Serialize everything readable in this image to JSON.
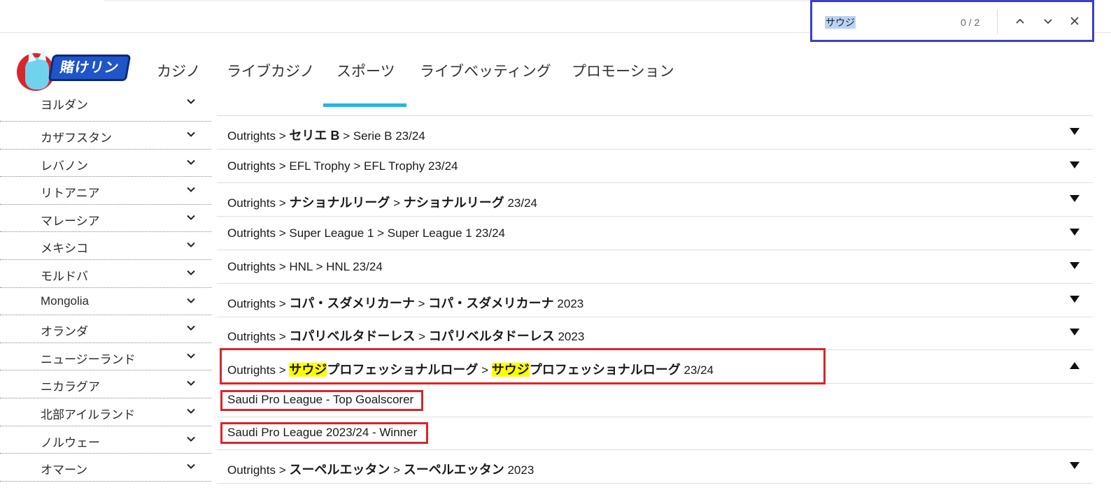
{
  "find_bar": {
    "query": "サウジ",
    "match_count": "0 / 2",
    "prev_icon": "chevron-up-icon",
    "next_icon": "chevron-down-icon",
    "close_icon": "close-icon",
    "border_color": "#3b3fc9"
  },
  "logo": {
    "text": "賭けリン"
  },
  "nav": {
    "items": [
      "カジノ",
      "ライブカジノ",
      "スポーツ",
      "ライブベッティング",
      "プロモーション"
    ],
    "active": "スポーツ",
    "active_color": "#1bb9e8"
  },
  "sidebar": {
    "partial_top_label": "ヨルダン",
    "items": [
      {
        "label": "カザフスタン"
      },
      {
        "label": "レバノン"
      },
      {
        "label": "リトアニア"
      },
      {
        "label": "マレーシア"
      },
      {
        "label": "メキシコ"
      },
      {
        "label": "モルドバ"
      },
      {
        "label": "Mongolia"
      },
      {
        "label": "オランダ"
      },
      {
        "label": "ニュージーランド"
      },
      {
        "label": "ニカラグア"
      },
      {
        "label": "北部アイルランド"
      },
      {
        "label": "ノルウェー"
      },
      {
        "label": "オマーン"
      }
    ],
    "chevron_icon": "chevron-down-icon"
  },
  "outrights": {
    "prefix": "Outrights",
    "separator": ">",
    "rows": [
      {
        "league": "セリエ B",
        "season": "Serie B 23/24"
      },
      {
        "league": "EFL Trophy",
        "season": "EFL Trophy 23/24"
      },
      {
        "league": "ナショナルリーグ",
        "season_name": "ナショナルリーグ",
        "season_year": "23/24"
      },
      {
        "league": "Super League 1",
        "season": "Super League 1 23/24"
      },
      {
        "league": "HNL",
        "season": "HNL 23/24"
      },
      {
        "league": "コパ・スダメリカーナ",
        "season_name": "コパ・スダメリカーナ",
        "season_year": "2023"
      },
      {
        "league": "コパリベルタドーレス",
        "season_name": "コパリベルタドーレス",
        "season_year": "2023"
      },
      {
        "league_highlight": "サウジ",
        "league_rest": "プロフェッショナルローグ",
        "season_highlight": "サウジ",
        "season_rest": "プロフェッショナルローグ",
        "season_year": "23/24",
        "expanded": true
      },
      {
        "league": "スーペルエッタン",
        "season_name": "スーペルエッタン",
        "season_year": "2023"
      }
    ],
    "markets": [
      "Saudi Pro League - Top Goalscorer",
      "Saudi Pro League 2023/24 - Winner"
    ],
    "collapsed_icon": "triangle-down-icon",
    "expanded_icon": "triangle-up-icon",
    "highlight_color": "#ffff00",
    "annotation_color": "#d7262d"
  }
}
